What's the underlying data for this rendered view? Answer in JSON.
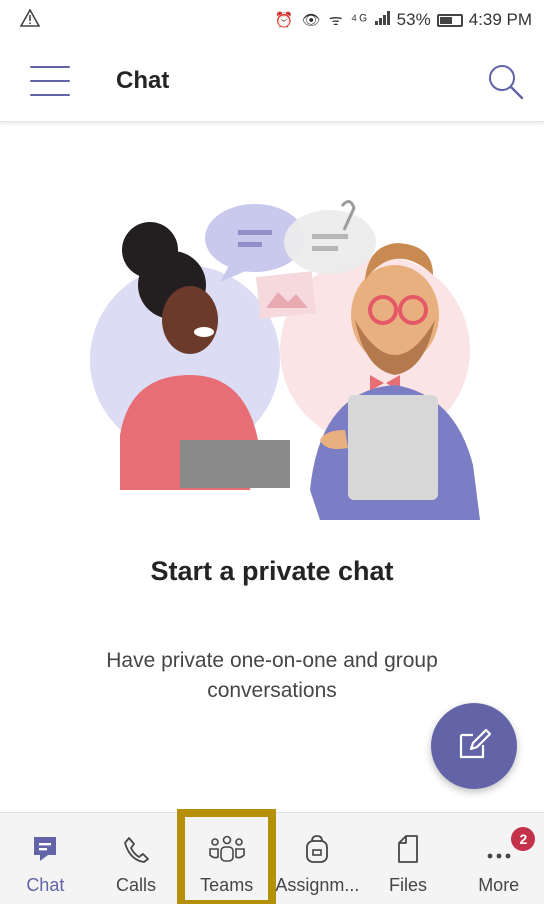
{
  "status_bar": {
    "warning_icon": "warning-triangle-icon",
    "icons": "⏰ 👁 ᯤ ⁴ᴳ",
    "battery": "53%",
    "time": "4:39 PM"
  },
  "app_bar": {
    "title": "Chat",
    "menu_icon": "hamburger-menu-icon",
    "search_icon": "search-icon"
  },
  "empty_state": {
    "title": "Start a private chat",
    "description": "Have private one-on-one and group conversations"
  },
  "fab": {
    "icon": "compose-icon"
  },
  "tabs": [
    {
      "label": "Chat",
      "icon": "chat-icon",
      "active": true
    },
    {
      "label": "Calls",
      "icon": "phone-icon"
    },
    {
      "label": "Teams",
      "icon": "teams-icon",
      "highlighted": true
    },
    {
      "label": "Assignm...",
      "icon": "assignments-icon"
    },
    {
      "label": "Files",
      "icon": "file-icon"
    },
    {
      "label": "More",
      "icon": "more-icon",
      "badge": "2"
    }
  ],
  "colors": {
    "accent": "#6264a7",
    "highlight_border": "#b5900a",
    "badge": "#c4314b"
  }
}
